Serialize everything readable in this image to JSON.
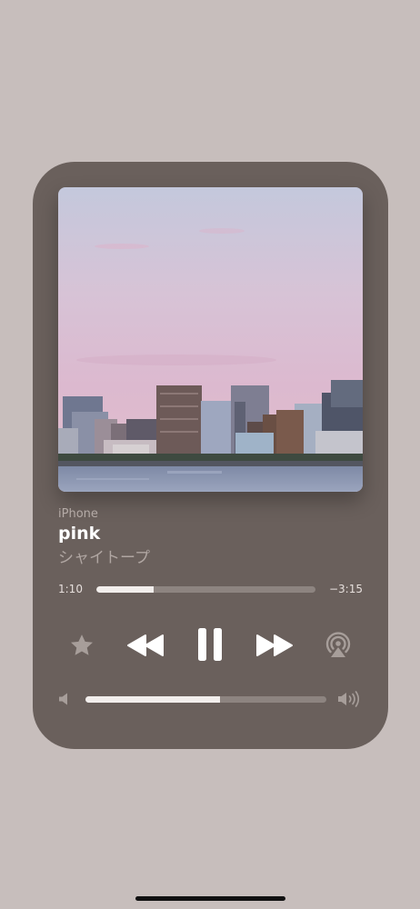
{
  "player": {
    "source": "iPhone",
    "title": "pink",
    "artist": "シャイトープ",
    "elapsed": "1:10",
    "remaining": "−3:15",
    "progress_fraction": 0.26,
    "volume_fraction": 0.56
  },
  "icons": {
    "favorite": "star-icon",
    "previous": "rewind-icon",
    "play_pause": "pause-icon",
    "next": "fast-forward-icon",
    "airplay": "airplay-icon",
    "volume_low": "speaker-low-icon",
    "volume_high": "speaker-high-icon"
  },
  "colors": {
    "background": "#c7bebc",
    "card": "#6a605c",
    "track": "#8d8480",
    "fill": "#f2eeec"
  }
}
